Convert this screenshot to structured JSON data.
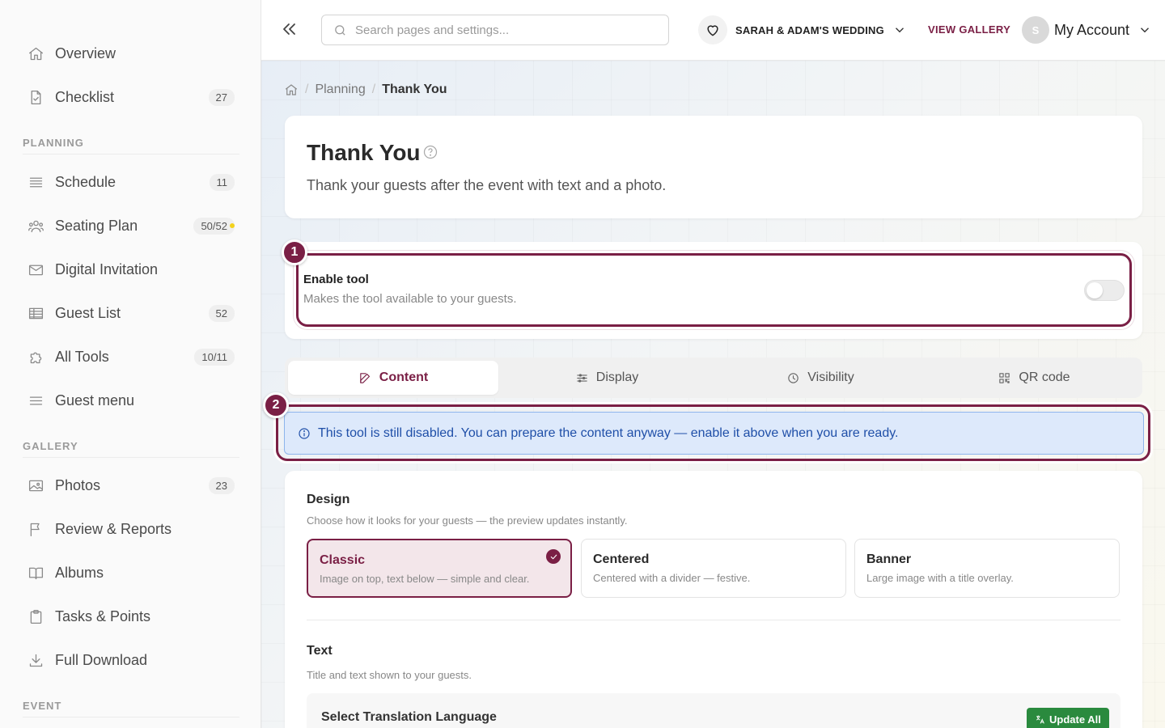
{
  "sidebar": {
    "items": [
      {
        "label": "Overview",
        "icon": "home-icon",
        "badge": ""
      },
      {
        "label": "Checklist",
        "icon": "checklist-icon",
        "badge": "27"
      },
      {
        "label": "Schedule",
        "icon": "schedule-icon",
        "badge": "11"
      },
      {
        "label": "Seating Plan",
        "icon": "seating-icon",
        "badge": "50/52"
      },
      {
        "label": "Digital Invitation",
        "icon": "mail-icon",
        "badge": ""
      },
      {
        "label": "Guest List",
        "icon": "table-icon",
        "badge": "52"
      },
      {
        "label": "All Tools",
        "icon": "puzzle-icon",
        "badge": "10/11"
      },
      {
        "label": "Guest menu",
        "icon": "menu-icon",
        "badge": ""
      },
      {
        "label": "Photos",
        "icon": "image-icon",
        "badge": "23"
      },
      {
        "label": "Review & Reports",
        "icon": "flag-icon",
        "badge": ""
      },
      {
        "label": "Albums",
        "icon": "book-icon",
        "badge": ""
      },
      {
        "label": "Tasks & Points",
        "icon": "clipboard-icon",
        "badge": ""
      },
      {
        "label": "Full Download",
        "icon": "download-icon",
        "badge": ""
      }
    ],
    "sections": {
      "planning": "PLANNING",
      "gallery": "GALLERY",
      "event": "EVENT"
    },
    "seating_dot_color": "#f3d21c"
  },
  "topbar": {
    "search_placeholder": "Search pages and settings...",
    "event_name": "SARAH & ADAM'S WEDDING",
    "view_gallery": "VIEW GALLERY",
    "avatar_initial": "S",
    "account_label": "My Account"
  },
  "breadcrumb": {
    "parent": "Planning",
    "current": "Thank You"
  },
  "page": {
    "title": "Thank You",
    "subtitle": "Thank your guests after the event with text and a photo."
  },
  "enable_tool": {
    "marker": "1",
    "title": "Enable tool",
    "description": "Makes the tool available to your guests.",
    "enabled": false
  },
  "tabs": [
    {
      "label": "Content",
      "icon": "edit-icon",
      "active": true
    },
    {
      "label": "Display",
      "icon": "sliders-icon",
      "active": false
    },
    {
      "label": "Visibility",
      "icon": "clock-icon",
      "active": false
    },
    {
      "label": "QR code",
      "icon": "qr-icon",
      "active": false
    }
  ],
  "alert": {
    "marker": "2",
    "text": "This tool is still disabled. You can prepare the content anyway — enable it above when you are ready."
  },
  "design": {
    "title": "Design",
    "subtitle": "Choose how it looks for your guests — the preview updates instantly.",
    "options": [
      {
        "title": "Classic",
        "desc": "Image on top, text below — simple and clear.",
        "selected": true
      },
      {
        "title": "Centered",
        "desc": "Centered with a divider — festive.",
        "selected": false
      },
      {
        "title": "Banner",
        "desc": "Large image with a title overlay.",
        "selected": false
      }
    ]
  },
  "text_section": {
    "title": "Text",
    "subtitle": "Title and text shown to your guests.",
    "language_label": "Select Translation Language",
    "update_all": "Update All"
  },
  "colors": {
    "accent": "#7a1f45",
    "alert_text": "#1f4fa8",
    "alert_bg": "#dde9fb",
    "success": "#2a8a3e"
  }
}
